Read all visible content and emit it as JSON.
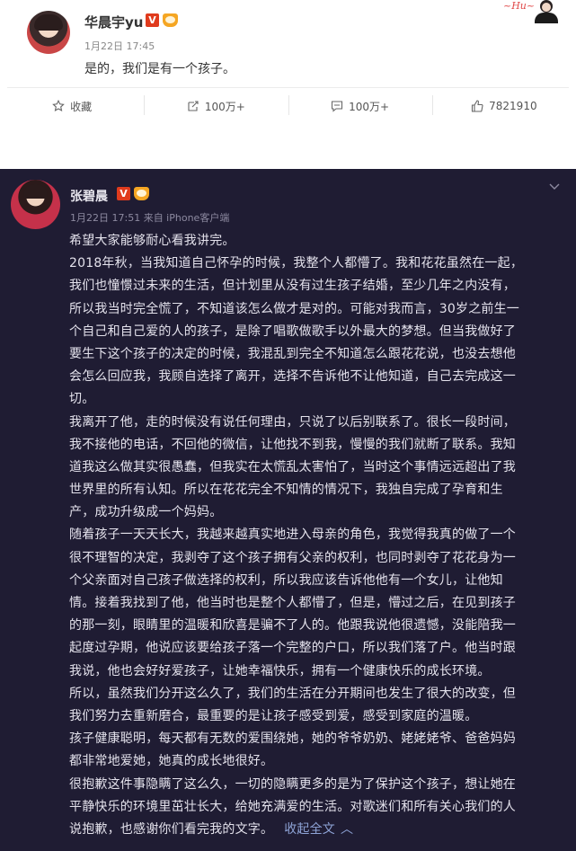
{
  "post1": {
    "username": "华晨宇yu",
    "verified_badge": "V",
    "timestamp": "1月22日 17:45",
    "content": "是的，我们是有一个孩子。",
    "actions": [
      {
        "icon": "star-icon",
        "label": "收藏"
      },
      {
        "icon": "repost-icon",
        "label": "100万+"
      },
      {
        "icon": "comment-icon",
        "label": "100万+"
      },
      {
        "icon": "like-icon",
        "label": "7821910"
      }
    ]
  },
  "post2": {
    "username": "张碧晨",
    "verified_badge": "V",
    "timestamp": "1月22日 17:51 来自 iPhone客户端",
    "lines": [
      "希望大家能够耐心看我讲完。",
      "2018年秋，当我知道自己怀孕的时候，我整个人都懵了。我和花花虽然在一起，",
      "我们也憧憬过未来的生活，但计划里从没有过生孩子结婚，至少几年之内没有，",
      "所以我当时完全慌了，不知道该怎么做才是对的。可能对我而言，30岁之前生一",
      "个自己和自己爱的人的孩子，是除了唱歌做歌手以外最大的梦想。但当我做好了",
      "要生下这个孩子的决定的时候，我混乱到完全不知道怎么跟花花说，也没去想他",
      "会怎么回应我，我顾自选择了离开，选择不告诉他不让他知道，自己去完成这一",
      "切。",
      "我离开了他，走的时候没有说任何理由，只说了以后别联系了。很长一段时间，",
      "我不接他的电话，不回他的微信，让他找不到我，慢慢的我们就断了联系。我知",
      "道我这么做其实很愚蠢，但我实在太慌乱太害怕了，当时这个事情远远超出了我",
      "世界里的所有认知。所以在花花完全不知情的情况下，我独自完成了孕育和生",
      "产，成功升级成一个妈妈。",
      "随着孩子一天天长大，我越来越真实地进入母亲的角色，我觉得我真的做了一个",
      "很不理智的决定，我剥夺了这个孩子拥有父亲的权利，也同时剥夺了花花身为一",
      "个父亲面对自己孩子做选择的权利，所以我应该告诉他他有一个女儿，让他知",
      "情。接着我找到了他，他当时也是整个人都懵了，但是，懵过之后，在见到孩子",
      "的那一刻，眼睛里的温暖和欣喜是骗不了人的。他跟我说他很遗憾，没能陪我一",
      "起度过孕期，他说应该要给孩子落一个完整的户口，所以我们落了户。他当时跟",
      "我说，他也会好好爱孩子，让她幸福快乐，拥有一个健康快乐的成长环境。",
      "所以，虽然我们分开这么久了，我们的生活在分开期间也发生了很大的改变，但",
      "我们努力去重新磨合，最重要的是让孩子感受到爱，感受到家庭的温暖。",
      "孩子健康聪明，每天都有无数的爱围绕她，她的爷爷奶奶、姥姥姥爷、爸爸妈妈",
      "都非常地爱她，她真的成长地很好。",
      "很抱歉这件事隐瞒了这么久，一切的隐瞒更多的是为了保护这个孩子，想让她在",
      "平静快乐的环境里茁壮长大，给她充满爱的生活。对歌迷们和所有关心我们的人"
    ],
    "last_line": "说抱歉，也感谢你们看完我的文字。",
    "collapse_label": "收起全文",
    "collapse_icon": "chevron-up-icon"
  },
  "colors": {
    "dark_bg": "#1f1c33",
    "badge_red": "#e03b1d",
    "link_blue": "#8ea3d6"
  }
}
